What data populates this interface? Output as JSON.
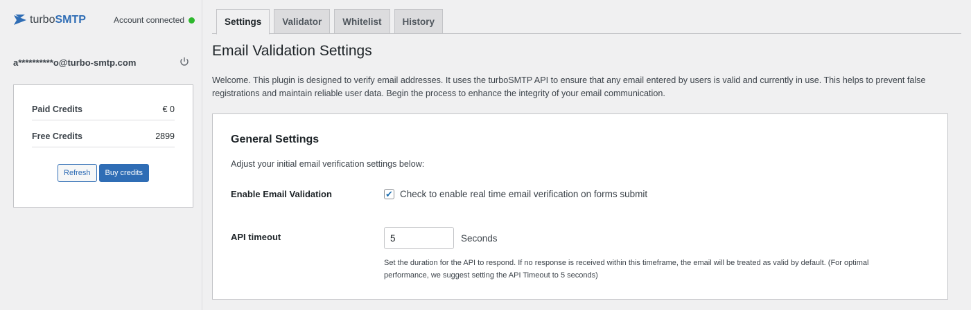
{
  "sidebar": {
    "logo": {
      "prefix": "turbo",
      "brand": "SMTP"
    },
    "status": "Account connected",
    "status_color": "#2eb82e",
    "email": "a**********o@turbo-smtp.com",
    "credits": [
      {
        "label": "Paid Credits",
        "value": "€ 0"
      },
      {
        "label": "Free Credits",
        "value": "2899"
      }
    ],
    "refresh_label": "Refresh",
    "buy_label": "Buy credits"
  },
  "tabs": [
    {
      "label": "Settings",
      "active": true
    },
    {
      "label": "Validator"
    },
    {
      "label": "Whitelist"
    },
    {
      "label": "History"
    }
  ],
  "main": {
    "title": "Email Validation Settings",
    "intro": "Welcome. This plugin is designed to verify email addresses. It uses the turboSMTP API to ensure that any email entered by users is valid and currently in use. This helps to prevent false registrations and maintain reliable user data. Begin the process to enhance the integrity of your email communication.",
    "panel": {
      "title": "General Settings",
      "subtitle": "Adjust your initial email verification settings below:",
      "enable_label": "Enable Email Validation",
      "enable_checked": true,
      "enable_text": "Check to enable real time email verification on forms submit",
      "timeout_label": "API timeout",
      "timeout_value": "5",
      "timeout_unit": "Seconds",
      "timeout_help": "Set the duration for the API to respond. If no response is received within this timeframe, the email will be treated as valid by default. (For optimal performance, we suggest setting the API Timeout to 5 seconds)"
    }
  },
  "accent": "#2f6db5"
}
